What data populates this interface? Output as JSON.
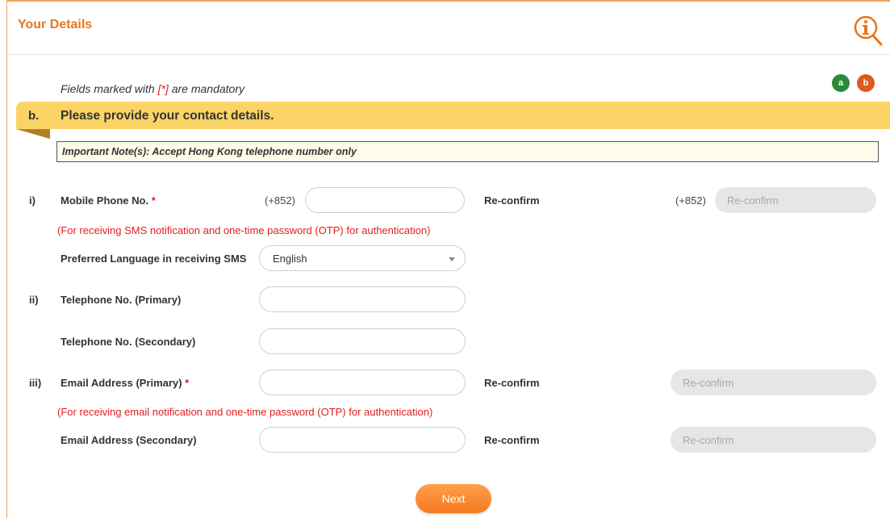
{
  "header": {
    "title": "Your Details",
    "info_icon": "info-magnifier-icon"
  },
  "steps": [
    {
      "label": "a",
      "color": "#2a8a3a"
    },
    {
      "label": "b",
      "color": "#dc5a1e"
    }
  ],
  "mandatory_note": {
    "prefix": "Fields marked with ",
    "mark": "[*]",
    "suffix": " are mandatory"
  },
  "section": {
    "letter": "b.",
    "title": "Please provide your contact details."
  },
  "important_note": "Important Note(s): Accept Hong Kong telephone number only",
  "form": {
    "mobile": {
      "index": "i)",
      "label": "Mobile Phone No.",
      "required": "*",
      "prefix": "(+852)",
      "value": "",
      "reconfirm_label": "Re-confirm",
      "reconfirm_prefix": "(+852)",
      "reconfirm_placeholder": "Re-confirm",
      "hint": "(For receiving SMS notification and one-time password (OTP) for authentication)"
    },
    "language": {
      "label": "Preferred Language in receiving SMS",
      "selected": "English"
    },
    "telephone_primary": {
      "index": "ii)",
      "label": "Telephone No. (Primary)",
      "value": ""
    },
    "telephone_secondary": {
      "label": "Telephone No. (Secondary)",
      "value": ""
    },
    "email_primary": {
      "index": "iii)",
      "label": "Email Address (Primary)",
      "required": "*",
      "value": "",
      "reconfirm_label": "Re-confirm",
      "reconfirm_placeholder": "Re-confirm",
      "hint": "(For receiving email notification and one-time password (OTP) for authentication)"
    },
    "email_secondary": {
      "label": "Email Address (Secondary)",
      "value": "",
      "reconfirm_label": "Re-confirm",
      "reconfirm_placeholder": "Re-confirm"
    }
  },
  "next_button": "Next",
  "colors": {
    "accent": "#e8761c",
    "section_bar": "#fbd468",
    "required": "#e02020",
    "button": "#f5791f"
  }
}
